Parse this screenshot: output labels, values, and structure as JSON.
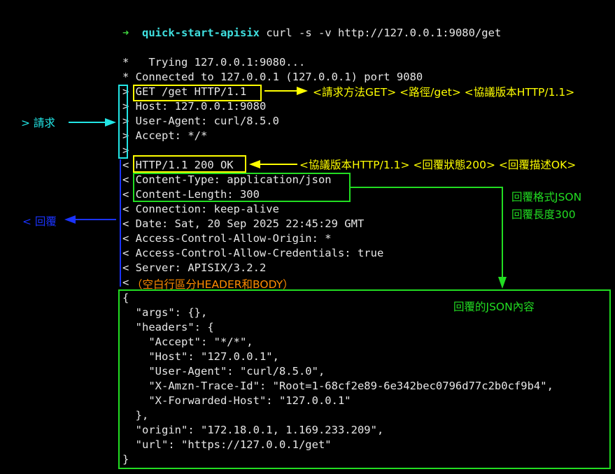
{
  "terminal": {
    "prompt_arrow": "➜",
    "prompt_dir": "quick-start-apisix",
    "command": "curl -s -v http://127.0.0.1:9080/get",
    "info_lines": [
      "*   Trying 127.0.0.1:9080...",
      "* Connected to 127.0.0.1 (127.0.0.1) port 9080"
    ],
    "request_lines": [
      "> GET /get HTTP/1.1",
      "> Host: 127.0.0.1:9080",
      "> User-Agent: curl/8.5.0",
      "> Accept: */*",
      ">"
    ],
    "response_lines": [
      "< HTTP/1.1 200 OK",
      "< Content-Type: application/json",
      "< Content-Length: 300",
      "< Connection: keep-alive",
      "< Date: Sat, 20 Sep 2025 22:45:29 GMT",
      "< Access-Control-Allow-Origin: *",
      "< Access-Control-Allow-Credentials: true",
      "< Server: APISIX/3.2.2",
      "<"
    ],
    "body_lines": [
      "{",
      "  \"args\": {},",
      "  \"headers\": {",
      "    \"Accept\": \"*/*\",",
      "    \"Host\": \"127.0.0.1\",",
      "    \"User-Agent\": \"curl/8.5.0\",",
      "    \"X-Amzn-Trace-Id\": \"Root=1-68cf2e89-6e342bec0796d77c2b0cf9b4\",",
      "    \"X-Forwarded-Host\": \"127.0.0.1\"",
      "  },",
      "  \"origin\": \"172.18.0.1, 1.169.233.209\",",
      "  \"url\": \"https://127.0.0.1/get\"",
      "}"
    ]
  },
  "annotations": {
    "request_line": "<請求方法GET> <路徑/get> <協議版本HTTP/1.1>",
    "request_label": "> 請求",
    "status_line": "<協議版本HTTP/1.1> <回覆狀態200> <回覆描述OK>",
    "response_label": "< 回覆",
    "format_label": "回覆格式JSON",
    "length_label": "回覆長度300",
    "blank_line_note": "（空白行區分HEADER和BODY）",
    "json_body_label": "回覆的JSON內容"
  },
  "colors": {
    "yellow": "#ffff00",
    "green": "#22dd22",
    "cyan": "#22e6e6",
    "blue": "#1a33ff",
    "orange": "#ff8c00"
  }
}
